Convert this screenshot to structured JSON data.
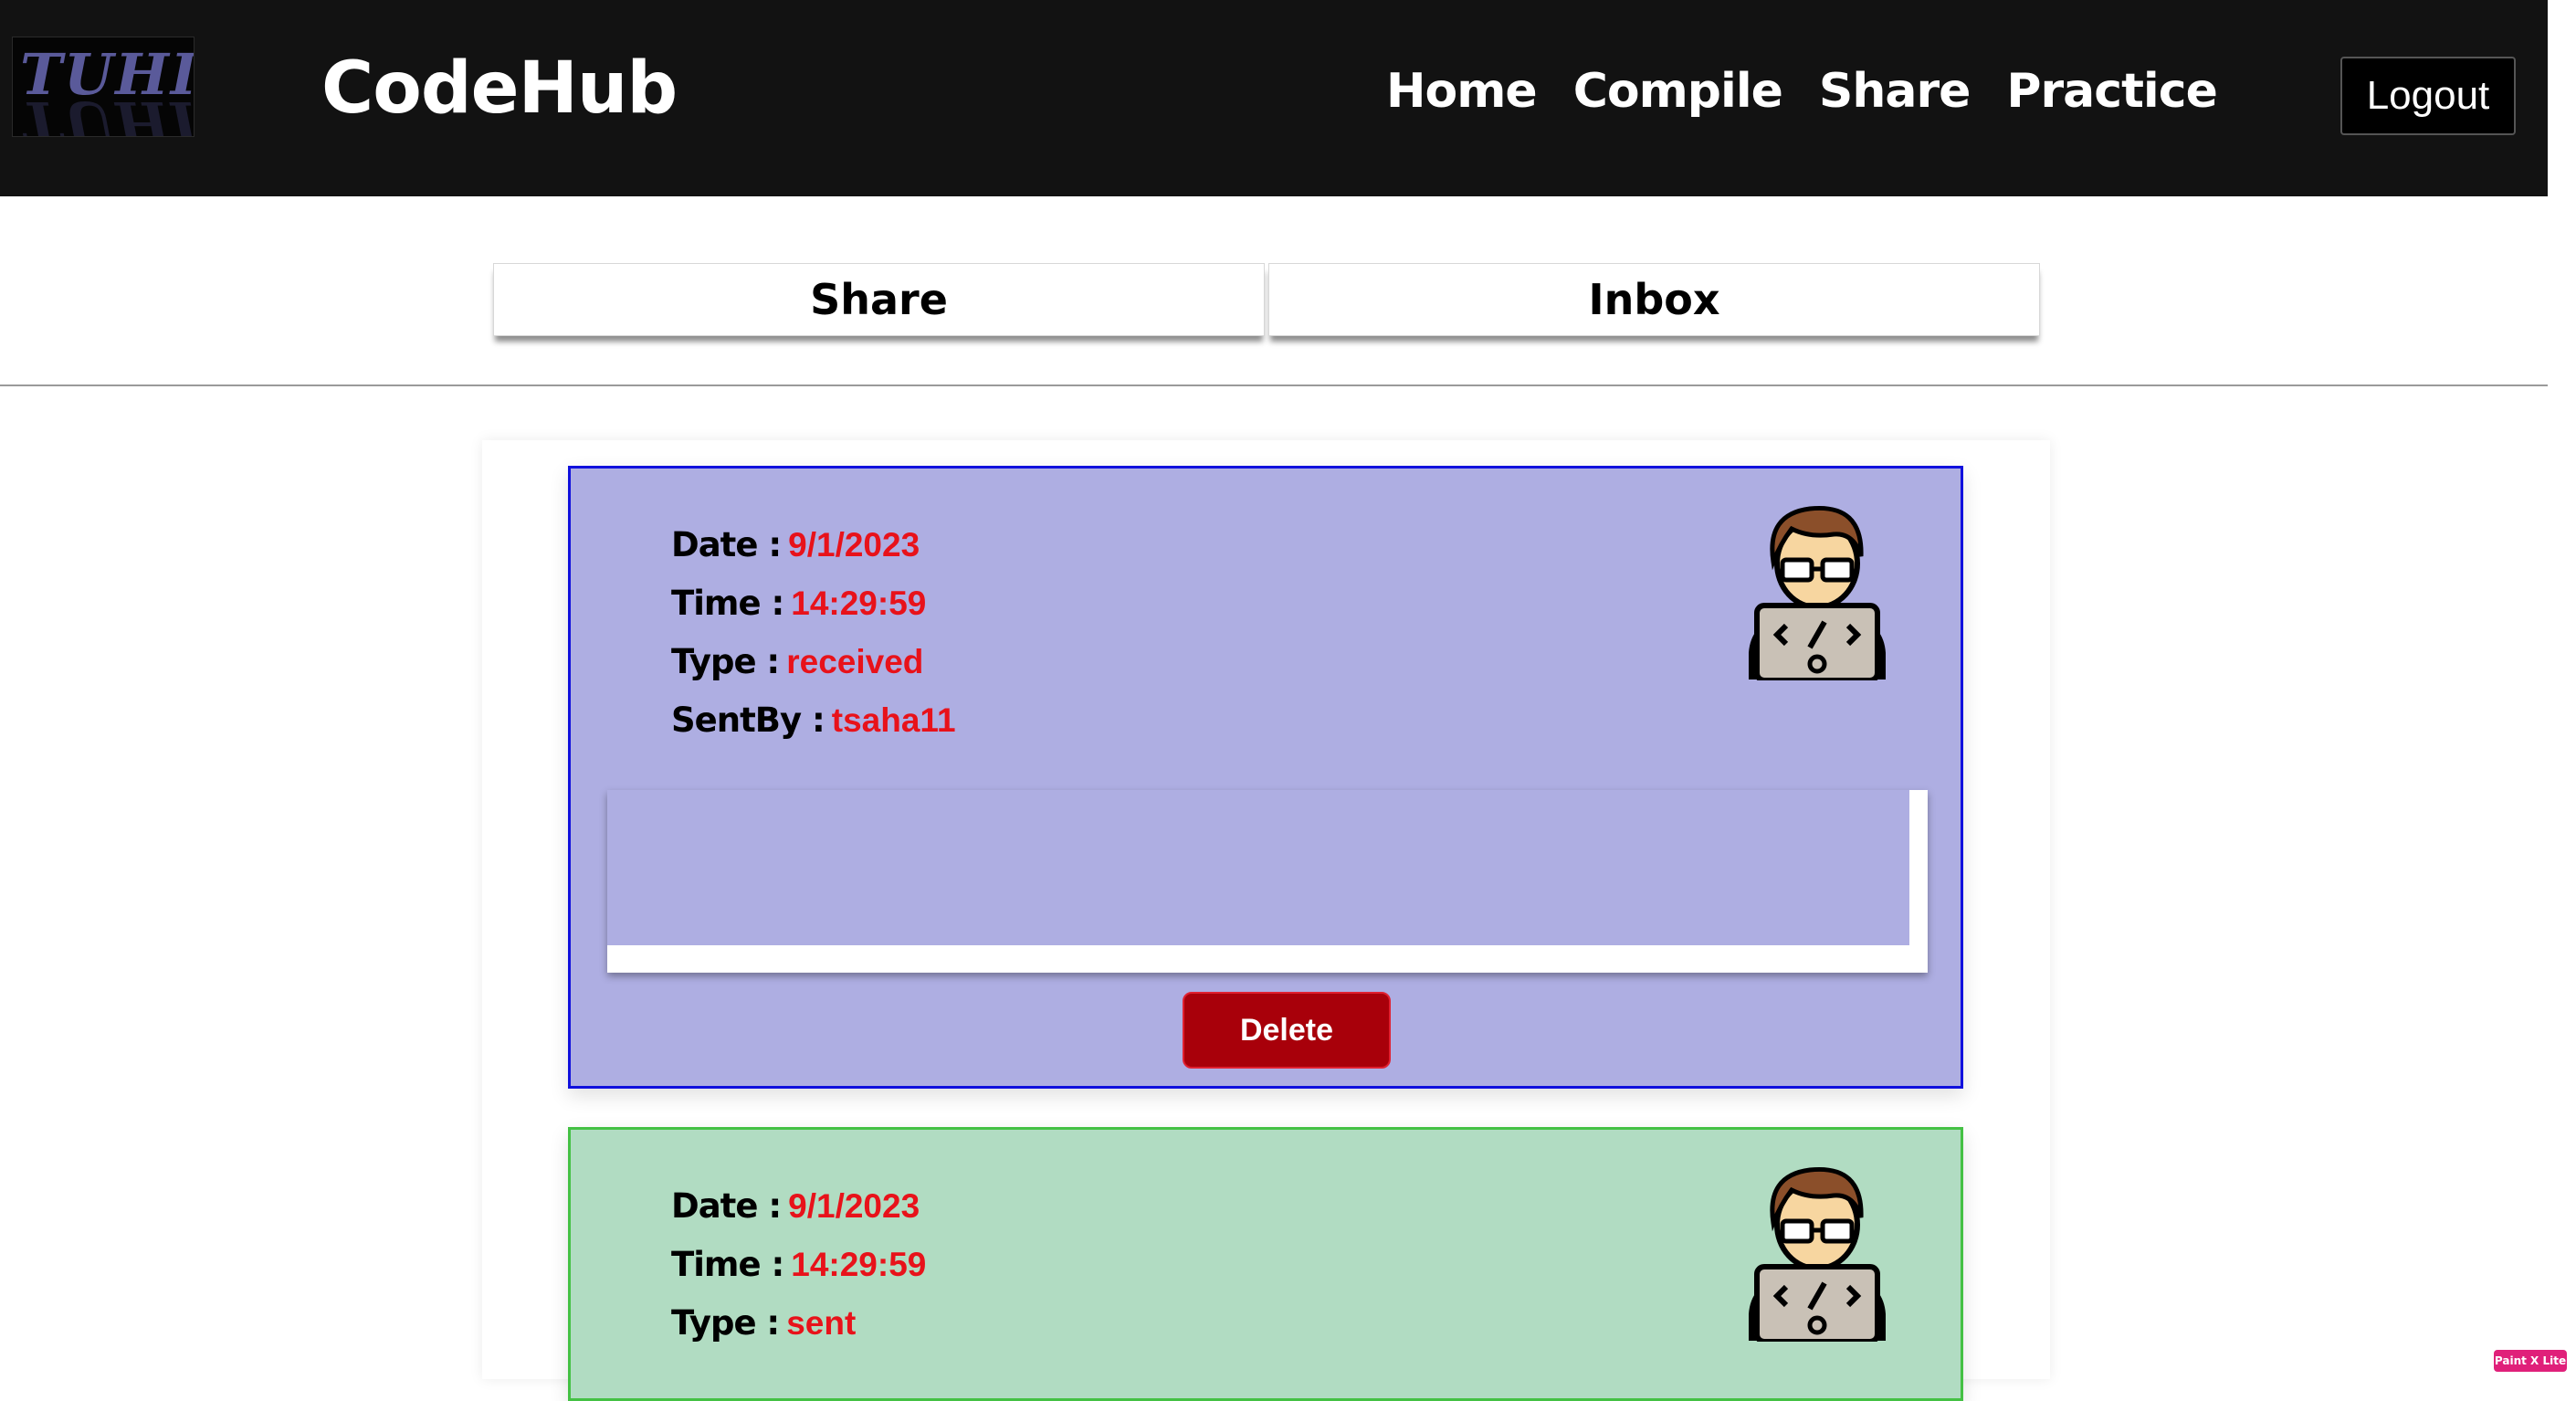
{
  "header": {
    "logo_text": "TUHIN",
    "brand": "CodeHub",
    "nav": [
      "Home",
      "Compile",
      "Share",
      "Practice"
    ],
    "logout_label": "Logout"
  },
  "tabs": {
    "share_label": "Share",
    "inbox_label": "Inbox"
  },
  "labels": {
    "date": "Date :",
    "time": "Time :",
    "type": "Type :",
    "sent_by": "SentBy :"
  },
  "messages": [
    {
      "date": "9/1/2023",
      "time": "14:29:59",
      "type": "received",
      "sent_by": "tsaha11",
      "delete_label": "Delete",
      "colors": {
        "background": "#aeaee2",
        "border": "#1010dd"
      }
    },
    {
      "date": "9/1/2023",
      "time": "14:29:59",
      "type": "sent",
      "colors": {
        "background": "#b1dcc2",
        "border": "#44c144"
      }
    }
  ],
  "badge": "Paint X Lite",
  "colors": {
    "header_bg": "#121212",
    "value_text": "#e8121a",
    "delete_button": "#a8000a"
  }
}
